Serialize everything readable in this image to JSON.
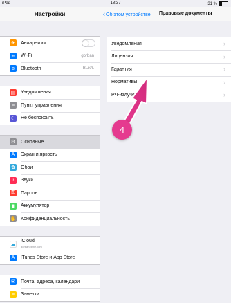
{
  "status_bar": {
    "carrier": "iPad",
    "time": "18:37",
    "battery": "31 %"
  },
  "left": {
    "title": "Настройки",
    "group1": [
      {
        "icon": "airplane-icon",
        "color": "#ff9500",
        "label": "Авиарежим",
        "value": ""
      },
      {
        "icon": "wifi-icon",
        "color": "#007aff",
        "label": "Wi-Fi",
        "value": "gorban"
      },
      {
        "icon": "bluetooth-icon",
        "color": "#007aff",
        "label": "Bluetooth",
        "value": "Выкл."
      }
    ],
    "group2": [
      {
        "icon": "notifications-icon",
        "color": "#ff3b30",
        "label": "Уведомления"
      },
      {
        "icon": "control-center-icon",
        "color": "#8e8e93",
        "label": "Пункт управления"
      },
      {
        "icon": "moon-icon",
        "color": "#5856d6",
        "label": "Не беспокоить"
      }
    ],
    "group3": [
      {
        "icon": "gear-icon",
        "color": "#8e8e93",
        "label": "Основные"
      },
      {
        "icon": "display-icon",
        "color": "#007aff",
        "label": "Экран и яркость"
      },
      {
        "icon": "wallpaper-icon",
        "color": "#34aadc",
        "label": "Обои"
      },
      {
        "icon": "sound-icon",
        "color": "#ff2d55",
        "label": "Звуки"
      },
      {
        "icon": "passcode-icon",
        "color": "#ff3b30",
        "label": "Пароль"
      },
      {
        "icon": "battery-icon",
        "color": "#4cd964",
        "label": "Аккумулятор"
      },
      {
        "icon": "privacy-icon",
        "color": "#8e8e93",
        "label": "Конфиденциальность"
      }
    ],
    "group4": {
      "icloud_label": "iCloud",
      "icloud_sub": "gorban@me.com",
      "itunes_label": "iTunes Store и App Store"
    },
    "group5": [
      {
        "icon": "mail-icon",
        "color": "#007aff",
        "label": "Почта, адреса, календари"
      },
      {
        "icon": "notes-icon",
        "color": "#ffcc00",
        "label": "Заметки"
      }
    ]
  },
  "right": {
    "back_label": "Об этом устройстве",
    "title": "Правовые документы",
    "items": [
      "Уведомления",
      "Лицензия",
      "Гарантия",
      "Нормативы",
      "РЧ-излучение"
    ]
  },
  "callout": {
    "number": "4",
    "color": "#e53a8f"
  }
}
